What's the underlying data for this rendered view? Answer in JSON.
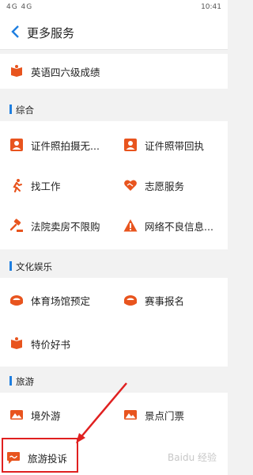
{
  "status": {
    "left": "4G 4G",
    "time": "10:41"
  },
  "header": {
    "title": "更多服务"
  },
  "top_item": {
    "label": "英语四六级成绩"
  },
  "sections": {
    "s1": {
      "title": "综合"
    },
    "s2": {
      "title": "文化娱乐"
    },
    "s3": {
      "title": "旅游"
    }
  },
  "items": {
    "a1": "证件照拍摄无...",
    "a2": "证件照带回执",
    "a3": "找工作",
    "a4": "志愿服务",
    "a5": "法院卖房不限购",
    "a6": "网络不良信息...",
    "b1": "体育场馆预定",
    "b2": "赛事报名",
    "b3": "特价好书",
    "c1": "境外游",
    "c2": "景点门票",
    "c3": "旅游投诉"
  },
  "colors": {
    "accent": "#1f7fe0",
    "icon": "#e8541e",
    "arrow": "#e02020"
  },
  "watermark": "Baidu 经验"
}
